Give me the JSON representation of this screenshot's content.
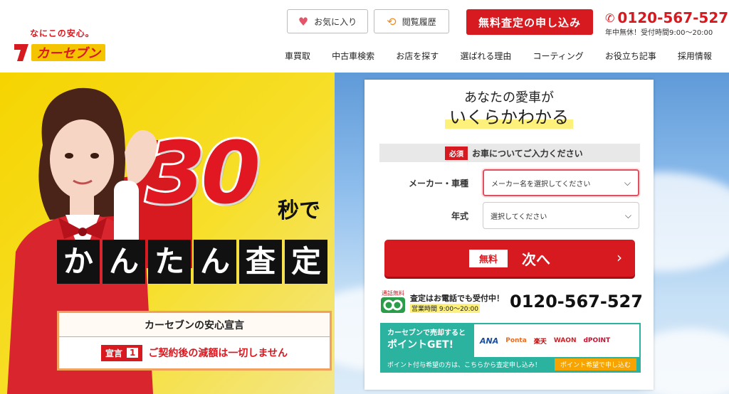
{
  "header": {
    "logo_tagline": "なにこの安心。",
    "logo_text": "カーセブン",
    "favorites_label": "お気に入り",
    "history_label": "閲覧履歴",
    "cta_label": "無料査定の申し込み",
    "phone_number": "0120-567-527",
    "phone_hours": "年中無休！受付時間9:00〜20:00"
  },
  "nav": {
    "items": [
      "車買取",
      "中古車検索",
      "お店を探す",
      "選ばれる理由",
      "コーティング",
      "お役立ち記事",
      "採用情報"
    ]
  },
  "hero": {
    "big_number": "30",
    "seconds": "秒で",
    "kantan_chars": [
      "か",
      "ん",
      "た",
      "ん",
      "査",
      "定"
    ],
    "declare_title": "カーセブンの安心宣言",
    "declare_badge": "宣言",
    "declare_badge_num": "1",
    "declare_text": "ご契約後の減額は一切しません"
  },
  "form": {
    "title_line1": "あなたの愛車が",
    "title_line2": "いくらかわかる",
    "required_badge": "必須",
    "required_text": "お車についてご入力ください",
    "maker_label": "メーカー・車種",
    "maker_placeholder": "メーカー名を選択してください",
    "year_label": "年式",
    "year_placeholder": "選択してください",
    "next_free": "無料",
    "next_label": "次へ",
    "tel_badge": "通話無料",
    "tel_text": "査定はお電話でも受付中！",
    "tel_hours": "営業時間 9:00〜20:00",
    "tel_number": "0120-567-527",
    "point_line1": "カーセブンで売却すると",
    "point_sell": "売却",
    "point_get": "ポイントGET!",
    "point_logos": [
      "ANA",
      "Ponta",
      "楽天",
      "WAON",
      "dPOINT"
    ],
    "point_note": "ポイント付与希望の方は、こちらから査定申し込み！",
    "point_cta": "ポイント希望で申し込む"
  }
}
